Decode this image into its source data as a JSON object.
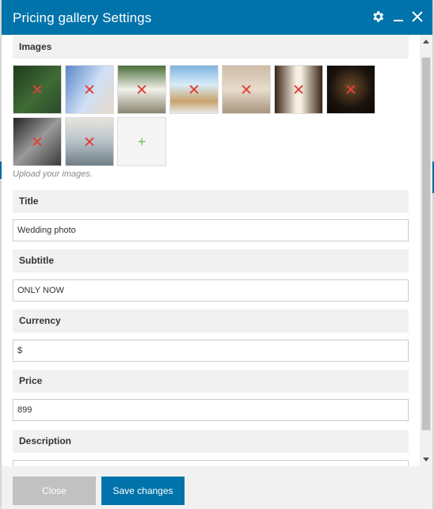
{
  "dialog": {
    "title": "Pricing gallery Settings",
    "icons": [
      "gear-icon",
      "minimize-icon",
      "close-icon"
    ]
  },
  "images": {
    "section_label": "Images",
    "help_text": "Upload your images.",
    "add_symbol": "+",
    "count": 9
  },
  "fields": {
    "title": {
      "label": "Title",
      "value": "Wedding photo"
    },
    "subtitle": {
      "label": "Subtitle",
      "value": "ONLY NOW"
    },
    "currency": {
      "label": "Currency",
      "value": "$"
    },
    "price": {
      "label": "Price",
      "value": "899"
    },
    "description": {
      "label": "Description",
      "value": ""
    }
  },
  "footer": {
    "close_label": "Close",
    "save_label": "Save changes"
  },
  "colors": {
    "primary": "#0073aa",
    "section_bg": "#f1f1f1",
    "remove_icon": "#e0413b",
    "add_icon": "#6bbf59"
  }
}
